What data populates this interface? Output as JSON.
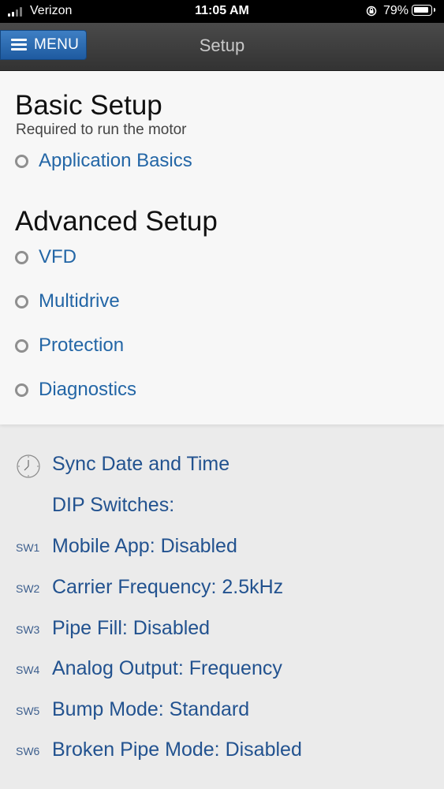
{
  "status_bar": {
    "carrier": "Verizon",
    "time": "11:05 AM",
    "battery_percent": "79%",
    "battery_level": 0.79
  },
  "header": {
    "menu_label": "MENU",
    "title": "Setup"
  },
  "basic_setup": {
    "title": "Basic Setup",
    "subtitle": "Required to run the motor",
    "items": [
      {
        "label": "Application Basics"
      }
    ]
  },
  "advanced_setup": {
    "title": "Advanced Setup",
    "items": [
      {
        "label": "VFD"
      },
      {
        "label": "Multidrive"
      },
      {
        "label": "Protection"
      },
      {
        "label": "Diagnostics"
      }
    ]
  },
  "sync": {
    "label": "Sync Date and Time"
  },
  "dip_switches": {
    "label": "DIP Switches:",
    "switches": [
      {
        "tag": "SW1",
        "text": "Mobile App: Disabled"
      },
      {
        "tag": "SW2",
        "text": "Carrier Frequency: 2.5kHz"
      },
      {
        "tag": "SW3",
        "text": "Pipe Fill: Disabled"
      },
      {
        "tag": "SW4",
        "text": "Analog Output: Frequency"
      },
      {
        "tag": "SW5",
        "text": "Bump Mode: Standard"
      },
      {
        "tag": "SW6",
        "text": "Broken Pipe Mode: Disabled"
      }
    ]
  },
  "colors": {
    "link_blue": "#2366a6",
    "menu_button": "#2a6cb3",
    "header_bg": "#3d3d3d"
  }
}
